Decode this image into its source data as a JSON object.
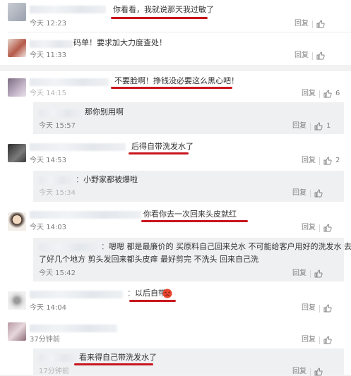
{
  "ui": {
    "reply_label": "回复",
    "like_icon": "thumb-up-icon"
  },
  "top": {
    "c1": {
      "text": "你看看，我就说那天我过敏了",
      "time": "今天 12:23"
    },
    "c2": {
      "text": "码单！要求加大力度查处！",
      "time": "今天 11:33"
    }
  },
  "thread": {
    "c1": {
      "text": "不要脸啊！挣钱没必要这么黑心吧！",
      "time": "今天 14:15",
      "likes": "6"
    },
    "r1": {
      "text": "那你别用啊",
      "time": "今天 15:57",
      "likes": "1"
    },
    "c2": {
      "text": "后得自带洗发水了",
      "time": "今天 14:53",
      "likes": "2"
    },
    "r2": {
      "text": "小野家都被爆啦",
      "time": "今天 15:34"
    },
    "c3": {
      "text": "你看你去一次回来头皮就红",
      "time": "今天 14:03"
    },
    "r3": {
      "text_line1": "嗯嗯 都是最廉价的 买原料自己回来兑水 不可能给客户用好的洗发水 去",
      "text_line2": "了好几个地方 剪头发回来都头皮痒 最好剪完 不洗头 回来自己洗",
      "time": "今天 15:42"
    },
    "c4": {
      "text": "以后自带",
      "time": "今天 14:04",
      "emoji": "angry-face-icon"
    },
    "c5": {
      "time": "37分钟前"
    },
    "r5": {
      "text": "看来得自己带洗发水了",
      "time": "17分钟前"
    }
  }
}
